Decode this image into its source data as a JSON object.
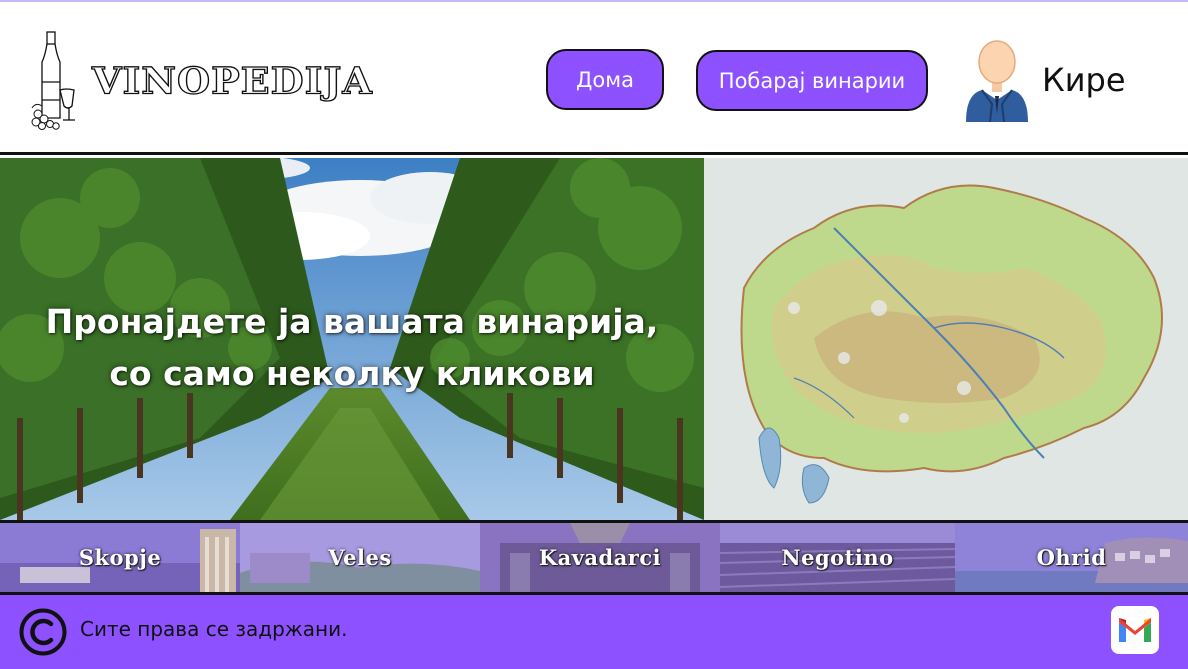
{
  "header": {
    "logo_text": "VINOPEDIJA",
    "nav": {
      "home_label": "Дома",
      "search_label": "Побарај винарии"
    },
    "user": {
      "name": "Кире"
    }
  },
  "hero": {
    "title_line1": "Пронајдете ја вашата винарија,",
    "title_line2": "со само неколку кликови"
  },
  "cities": [
    {
      "name": "Skopje"
    },
    {
      "name": "Veles"
    },
    {
      "name": "Kavadarci"
    },
    {
      "name": "Negotino"
    },
    {
      "name": "Ohrid"
    }
  ],
  "footer": {
    "copyright_text": "Сите права се задржани.",
    "mail_icon": "gmail-icon"
  },
  "colors": {
    "accent": "#8d51ff",
    "border": "#111111"
  }
}
